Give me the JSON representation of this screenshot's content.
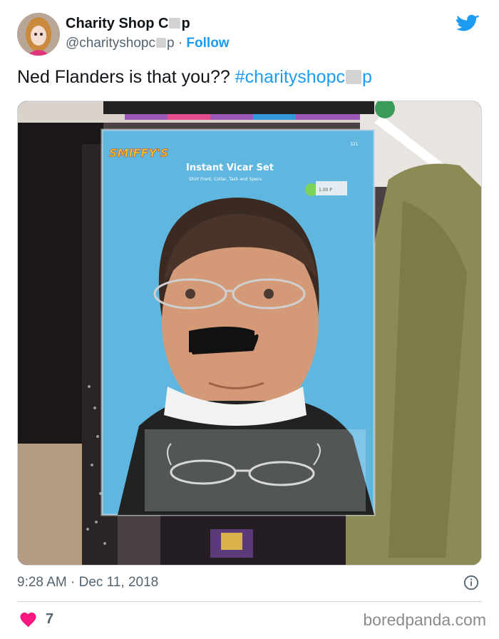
{
  "tweet": {
    "author_name_prefix": "Charity Shop C",
    "author_name_suffix": "p",
    "handle_prefix": "@charityshopc",
    "handle_suffix": "p",
    "separator": "·",
    "follow_label": "Follow",
    "text_prefix": "Ned Flanders is that you?? ",
    "hashtag_prefix": "#charityshopc",
    "hashtag_suffix": "p",
    "time": "9:28 AM",
    "date": "Dec 11, 2018",
    "likes": "7"
  },
  "photo": {
    "brand": "SMIFFY'S",
    "product_title": "Instant Vicar Set",
    "product_subtitle": "Shirt Front, Collar, Tash and Specs",
    "code": "321",
    "price_tag": "1.00 P"
  },
  "watermark": "boredpanda.com",
  "colors": {
    "link": "#1d9bf0",
    "heart": "#f91880",
    "muted": "#536471"
  },
  "icons": [
    "twitter-bird-icon",
    "info-icon",
    "heart-icon"
  ]
}
